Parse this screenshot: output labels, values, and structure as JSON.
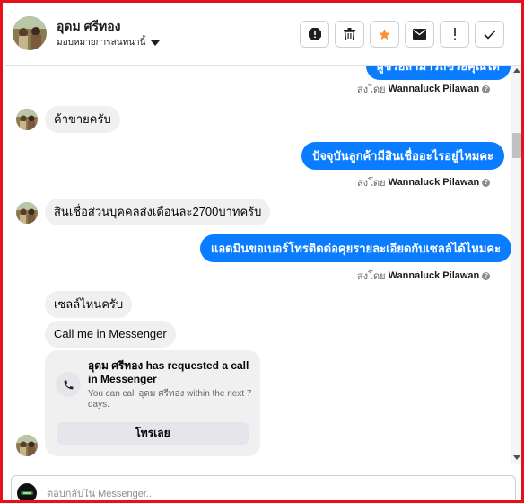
{
  "header": {
    "contact_name": "อุดม ศรีทอง",
    "assign_label": "มอบหมายการสนทนานี้",
    "actions": [
      {
        "name": "report-icon",
        "label": "Report"
      },
      {
        "name": "trash-icon",
        "label": "Delete"
      },
      {
        "name": "star-icon",
        "label": "Star"
      },
      {
        "name": "envelope-icon",
        "label": "Mark unread"
      },
      {
        "name": "exclamation-icon",
        "label": "Spam"
      },
      {
        "name": "check-icon",
        "label": "Done"
      }
    ],
    "star_color": "#f7923b"
  },
  "messages": [
    {
      "direction": "out",
      "text": "ผู้ช่วยสามารถช่วยคุณได้"
    },
    {
      "direction": "sent_by",
      "prefix": "ส่งโดย",
      "name": "Wannaluck Pilawan"
    },
    {
      "direction": "in",
      "text": "ค้าขายครับ"
    },
    {
      "direction": "out",
      "text": "ปัจจุบันลูกค้ามีสินเชื่ออะไรอยู่ไหมคะ"
    },
    {
      "direction": "sent_by",
      "prefix": "ส่งโดย",
      "name": "Wannaluck Pilawan"
    },
    {
      "direction": "in",
      "text": "สินเชื่อส่วนบุคคลส่งเดือนละ2700บาทครับ"
    },
    {
      "direction": "out",
      "text": "แอดมินขอเบอร์โทรติดต่อคุยรายละเอียดกับเซลล์ได้ไหมคะ"
    },
    {
      "direction": "sent_by",
      "prefix": "ส่งโดย",
      "name": "Wannaluck Pilawan"
    },
    {
      "direction": "in",
      "text": "เซลล์ไหนครับ"
    },
    {
      "direction": "in",
      "text": "Call me in Messenger"
    }
  ],
  "call_card": {
    "title": "อุดม ศรีทอง has requested a call in Messenger",
    "subtitle": "You can call อุดม ศรีทอง within the next 7 days.",
    "button": "โทรเลย"
  },
  "reply": {
    "placeholder": "ตอบกลับใน Messenger..."
  },
  "colors": {
    "outgoing_bubble": "#0a7cff",
    "incoming_bubble": "#f0f0f0",
    "frame_border": "#e8101a"
  }
}
